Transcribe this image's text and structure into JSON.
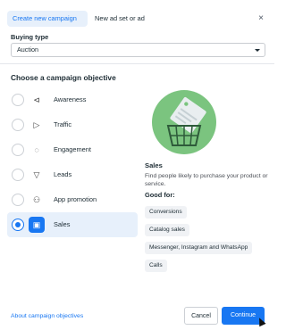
{
  "tabs": {
    "create_label": "Create new campaign",
    "new_adset_label": "New ad set or ad"
  },
  "close_glyph": "×",
  "buying": {
    "label": "Buying type",
    "value": "Auction"
  },
  "objectives": {
    "title": "Choose a campaign objective",
    "items": [
      {
        "label": "Awareness",
        "icon": "megaphone-icon",
        "glyph": "⊲"
      },
      {
        "label": "Traffic",
        "icon": "cursor-icon",
        "glyph": "▷"
      },
      {
        "label": "Engagement",
        "icon": "chat-bubble-icon",
        "glyph": "◌"
      },
      {
        "label": "Leads",
        "icon": "filter-icon",
        "glyph": "▽"
      },
      {
        "label": "App promotion",
        "icon": "people-icon",
        "glyph": "⚇"
      },
      {
        "label": "Sales",
        "icon": "shopping-bag-icon",
        "glyph": "▣"
      }
    ],
    "selected_index": 5
  },
  "detail": {
    "title": "Sales",
    "description": "Find people likely to purchase your product or service.",
    "good_for_label": "Good for:",
    "chips": [
      "Conversions",
      "Catalog sales",
      "Messenger, Instagram and WhatsApp",
      "Calls"
    ]
  },
  "footer": {
    "link": "About campaign objectives",
    "cancel": "Cancel",
    "continue": "Continue"
  },
  "colors": {
    "accent": "#1877f2",
    "illustration_green": "#7bc47f"
  }
}
